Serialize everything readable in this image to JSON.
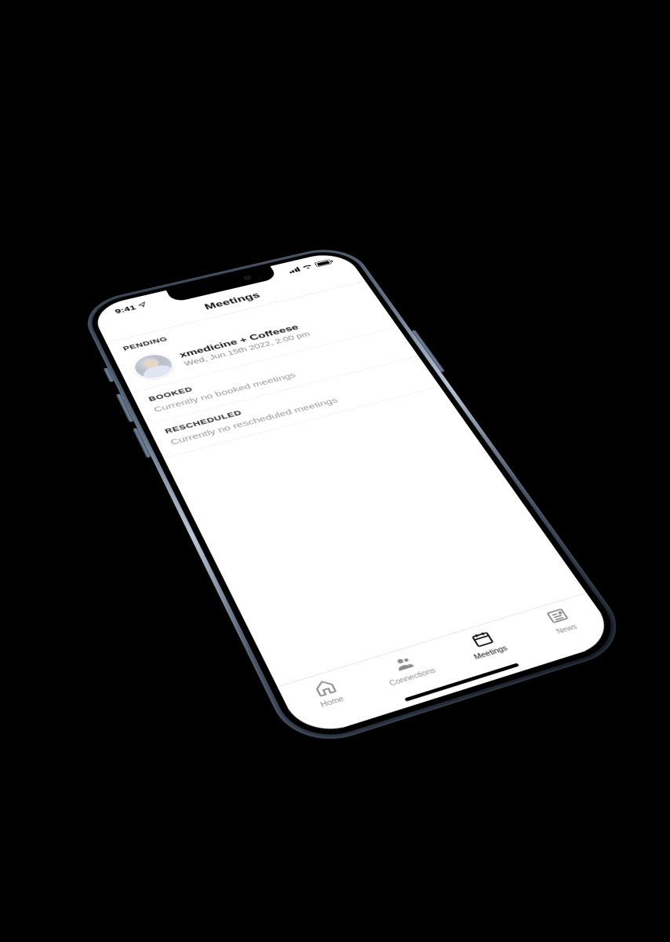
{
  "status_bar": {
    "time": "9:41",
    "location_icon": "location-arrow-icon",
    "signal_icon": "signal-icon",
    "wifi_icon": "wifi-icon",
    "battery_icon": "battery-icon"
  },
  "header": {
    "title": "Meetings"
  },
  "sections": {
    "pending": {
      "label": "PENDING",
      "items": [
        {
          "title": "xmedicine + Coffeese",
          "datetime": "Wed, Jun 15th 2022, 2:00 pm",
          "avatar": "person-avatar"
        }
      ]
    },
    "booked": {
      "label": "BOOKED",
      "empty_text": "Currently no booked meetings"
    },
    "rescheduled": {
      "label": "RESCHEDULED",
      "empty_text": "Currently no rescheduled meetings"
    }
  },
  "tabbar": {
    "items": [
      {
        "label": "Home",
        "icon": "home-icon",
        "active": false
      },
      {
        "label": "Connections",
        "icon": "people-icon",
        "active": false
      },
      {
        "label": "Meetings",
        "icon": "calendar-icon",
        "active": true
      },
      {
        "label": "News",
        "icon": "news-icon",
        "active": false
      }
    ]
  }
}
